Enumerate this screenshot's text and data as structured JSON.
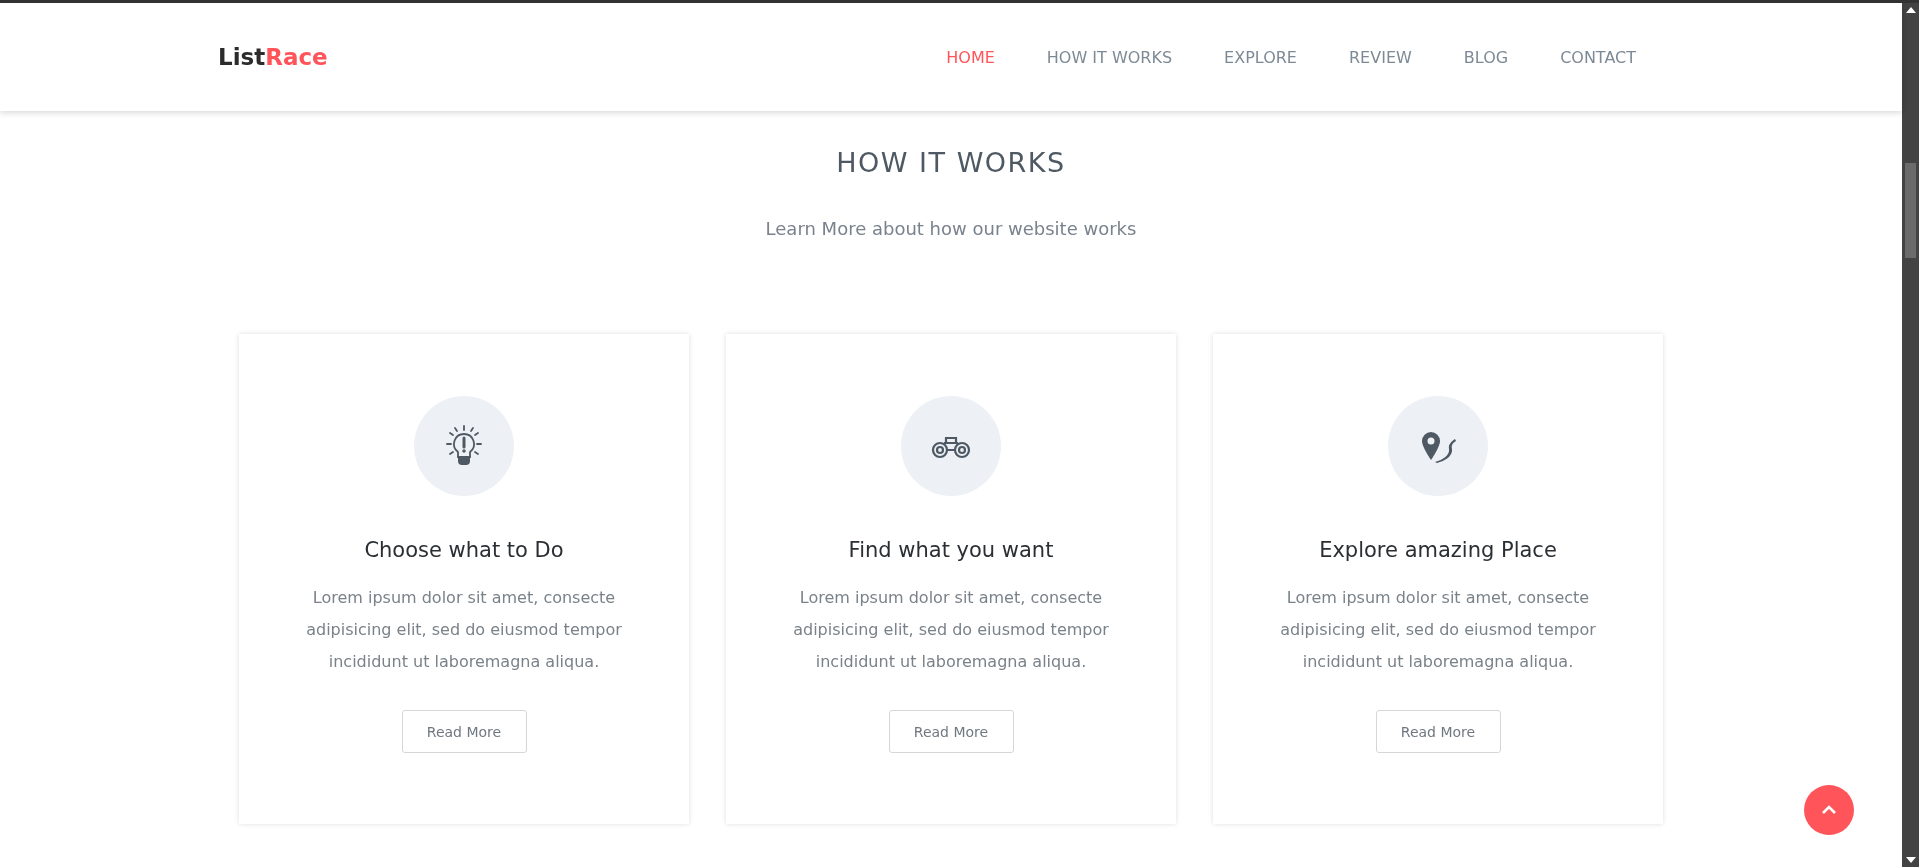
{
  "logo": {
    "first": "List",
    "second": "Race"
  },
  "nav": [
    {
      "label": "HOME",
      "selected": true
    },
    {
      "label": "HOW IT WORKS",
      "selected": false
    },
    {
      "label": "EXPLORE",
      "selected": false
    },
    {
      "label": "REVIEW",
      "selected": false
    },
    {
      "label": "BLOG",
      "selected": false
    },
    {
      "label": "CONTACT",
      "selected": false
    }
  ],
  "section": {
    "title": "HOW IT WORKS",
    "subtitle": "Learn More about how our website works"
  },
  "cards": [
    {
      "title": "Choose what to Do",
      "text": "Lorem ipsum dolor sit amet, consecte adipisicing elit, sed do eiusmod tempor incididunt ut laboremagna aliqua.",
      "button": "Read More"
    },
    {
      "title": "Find what you want",
      "text": "Lorem ipsum dolor sit amet, consecte adipisicing elit, sed do eiusmod tempor incididunt ut laboremagna aliqua.",
      "button": "Read More"
    },
    {
      "title": "Explore amazing Place",
      "text": "Lorem ipsum dolor sit amet, consecte adipisicing elit, sed do eiusmod tempor incididunt ut laboremagna aliqua.",
      "button": "Read More"
    }
  ]
}
